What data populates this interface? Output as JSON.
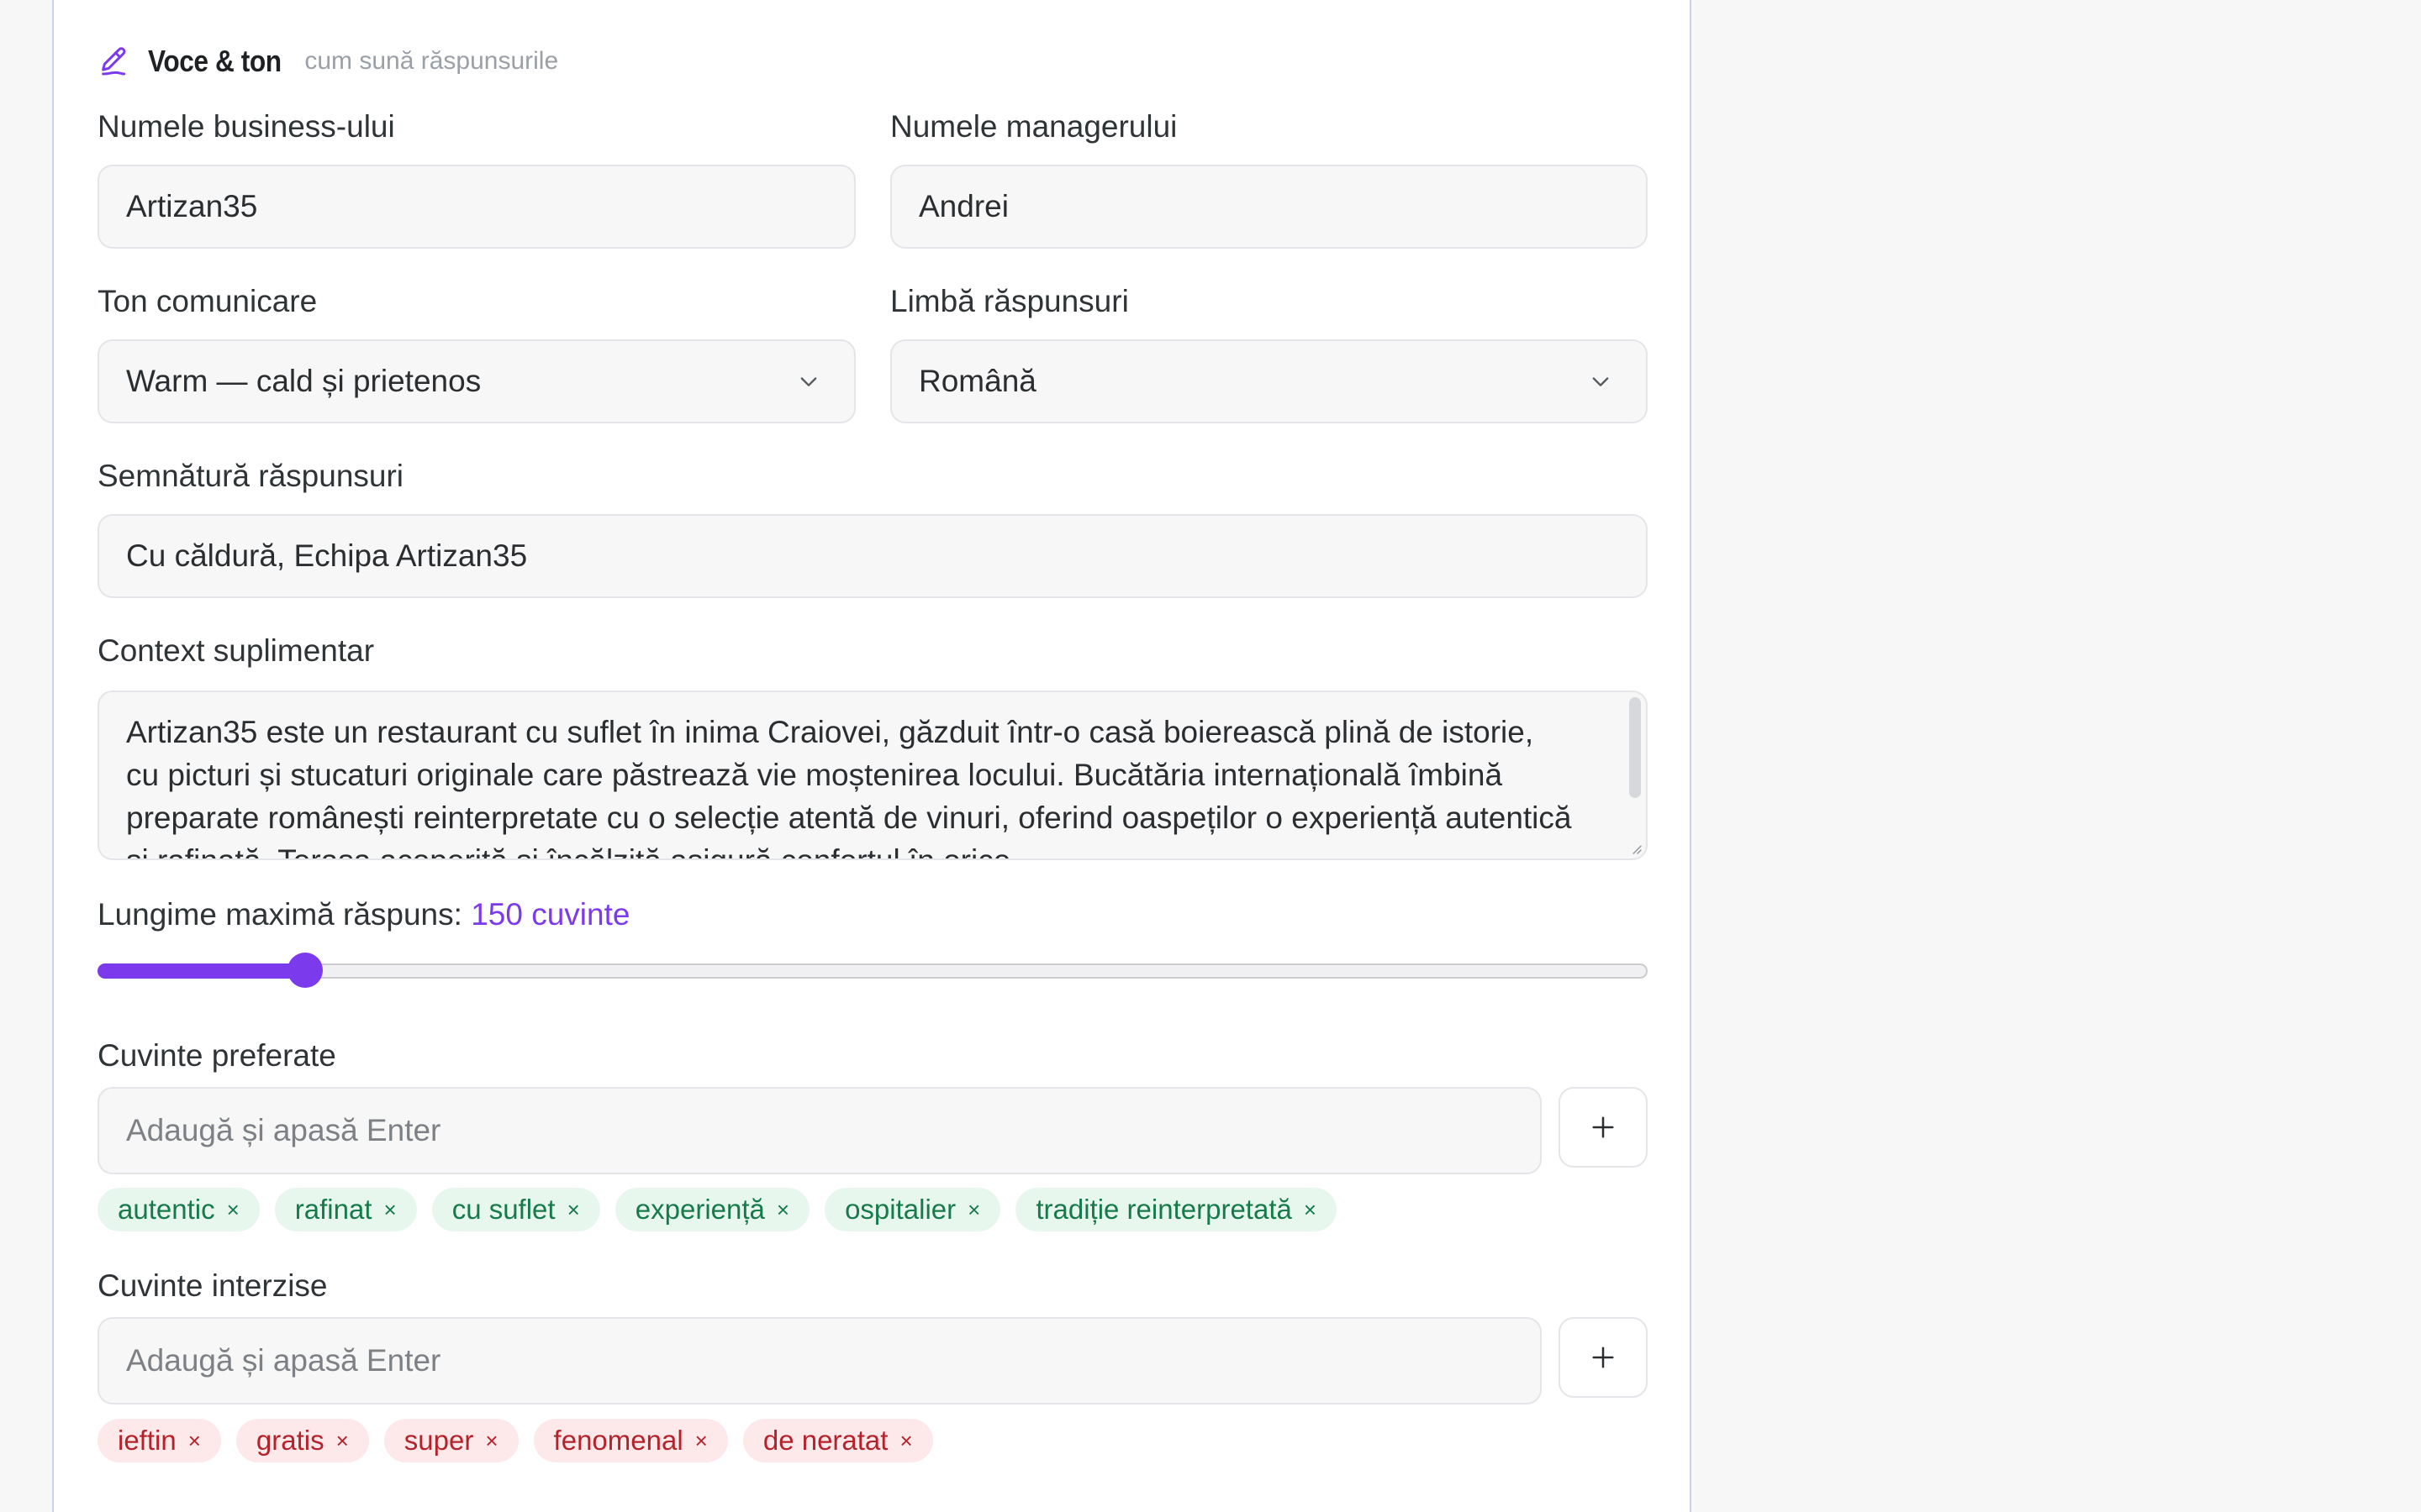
{
  "section": {
    "icon": "pen-icon",
    "title": "Voce & ton",
    "subtitle": "cum sună răspunsurile"
  },
  "business_name": {
    "label": "Numele business-ului",
    "value": "Artizan35"
  },
  "manager_name": {
    "label": "Numele managerului",
    "value": "Andrei"
  },
  "tone": {
    "label": "Ton comunicare",
    "value": "Warm — cald și prietenos"
  },
  "language": {
    "label": "Limbă răspunsuri",
    "value": "Română"
  },
  "signature": {
    "label": "Semnătură răspunsuri",
    "value": "Cu căldură, Echipa Artizan35"
  },
  "context": {
    "label": "Context suplimentar",
    "value": "Artizan35 este un restaurant cu suflet în inima Craiovei, găzduit într-o casă boierească plină de istorie, cu picturi și stucaturi originale care păstrează vie moștenirea locului. Bucătăria internațională îmbină preparate românești reinterpretate cu o selecție atentă de vinuri, oferind oaspeților o experiență autentică și rafinată. Terasa acoperită și încălzită asigură confortul în orice"
  },
  "max_length": {
    "label": "Lungime maximă răspuns:",
    "value_text": "150 cuvinte",
    "value": 150,
    "fraction": 0.134
  },
  "preferred_words": {
    "label": "Cuvinte preferate",
    "placeholder": "Adaugă și apasă Enter",
    "add_icon": "plus-icon",
    "items": [
      "autentic",
      "rafinat",
      "cu suflet",
      "experiență",
      "ospitalier",
      "tradiție reinterpretată"
    ]
  },
  "forbidden_words": {
    "label": "Cuvinte interzise",
    "placeholder": "Adaugă și apasă Enter",
    "add_icon": "plus-icon",
    "items": [
      "ieftin",
      "gratis",
      "super",
      "fenomenal",
      "de neratat"
    ]
  },
  "colors": {
    "accent": "#7c3aed",
    "preferred_bg": "#e8f7ee",
    "preferred_text": "#167a4a",
    "forbidden_bg": "#fde9ea",
    "forbidden_text": "#b4232c"
  }
}
